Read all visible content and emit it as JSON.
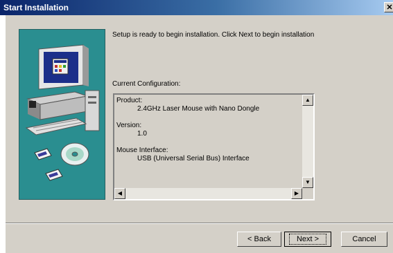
{
  "window": {
    "title": "Start Installation",
    "close_label": "✕"
  },
  "main": {
    "message": "Setup is ready to begin installation. Click Next to begin installation",
    "config_label": "Current Configuration:"
  },
  "config": {
    "product_label": "Product:",
    "product_value": "2.4GHz Laser Mouse with Nano Dongle",
    "version_label": "Version:",
    "version_value": "1.0",
    "interface_label": "Mouse Interface:",
    "interface_value": "USB (Universal Serial Bus) Interface"
  },
  "scroll": {
    "up": "▲",
    "down": "▼",
    "left": "◀",
    "right": "▶"
  },
  "buttons": {
    "back": "< Back",
    "next": "Next >",
    "cancel": "Cancel"
  },
  "colors": {
    "titlebar_start": "#0a246a",
    "titlebar_end": "#a6caf0",
    "panel": "#2a8e90",
    "face": "#d4d0c8"
  }
}
